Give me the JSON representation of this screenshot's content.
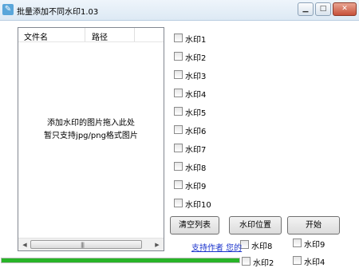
{
  "window": {
    "title": "批量添加不同水印1.03",
    "app_icon": "app-logo-icon",
    "min_icon": "minimize-icon",
    "max_icon": "maximize-icon",
    "close_icon": "close-icon"
  },
  "filelist": {
    "columns": [
      "文件名",
      "路径"
    ],
    "hint_line1": "添加水印的图片拖入此处",
    "hint_line2": "暂只支持jpg/png格式图片"
  },
  "watermarks": [
    "水印1",
    "水印2",
    "水印3",
    "水印4",
    "水印5",
    "水印6",
    "水印7",
    "水印8",
    "水印9",
    "水印10"
  ],
  "overlay_watermarks": [
    "水印8",
    "水印9",
    "水印2",
    "水印4"
  ],
  "buttons": {
    "clear": "清空列表",
    "position": "水印位置",
    "start": "开始"
  },
  "support_link": "支持作者 您的",
  "progress": {
    "fraction": 1.0,
    "color": "#28b428"
  }
}
